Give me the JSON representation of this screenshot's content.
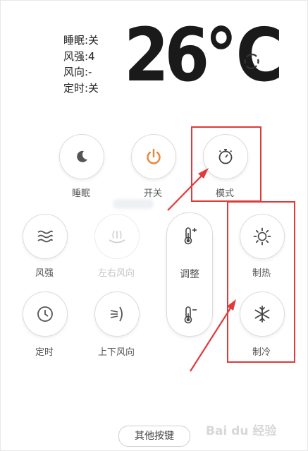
{
  "status": {
    "sleep": "睡眠:关",
    "wind_strength": "风强:4",
    "wind_direction": "风向:-",
    "timer": "定时:关"
  },
  "temperature": "26℃",
  "controls": {
    "sleep": "睡眠",
    "power": "开关",
    "mode": "模式",
    "wind_strength": "风强",
    "left_right_wind": "左右风向",
    "adjust": "调整",
    "heat": "制热",
    "timer": "定时",
    "up_down_wind": "上下风向",
    "cool": "制冷"
  },
  "other_keys": "其他按键",
  "watermark": "Bai du 经验",
  "colors": {
    "accent_power": "#e8863a",
    "annotation_red": "#e03a3a",
    "icon_gray": "#666666",
    "disabled_gray": "#c6c6c6"
  }
}
